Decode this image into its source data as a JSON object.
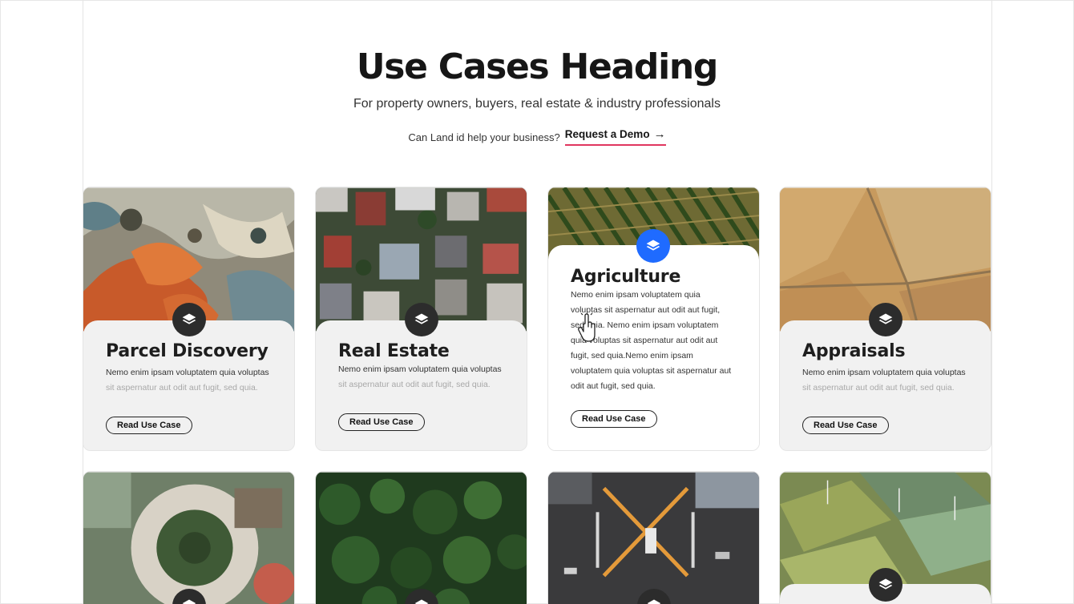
{
  "header": {
    "title": "Use Cases Heading",
    "subtitle": "For property owners, buyers, real estate & industry professionals",
    "cta_prompt": "Can Land id  help your business?",
    "cta_link": "Request a Demo",
    "accent_color": "#e0365f"
  },
  "cards": [
    {
      "title": "Parcel Discovery",
      "desc_main": "Nemo enim ipsam voluptatem quia voluptas",
      "desc_fade": "sit aspernatur aut odit aut fugit, sed quia.",
      "button": "Read Use Case",
      "icon": "layers-icon"
    },
    {
      "title": "Real Estate",
      "desc_main": "Nemo enim ipsam voluptatem quia voluptas",
      "desc_fade": "sit aspernatur aut odit aut fugit, sed quia.",
      "button": "Read Use Case",
      "icon": "layers-icon"
    },
    {
      "title": "Agriculture",
      "desc_main": "Nemo enim ipsam voluptatem quia voluptas sit aspernatur aut odit aut fugit, sed quia. Nemo enim ipsam voluptatem quia voluptas sit aspernatur aut odit aut fugit, sed quia.Nemo enim ipsam voluptatem quia voluptas sit aspernatur aut odit aut fugit, sed quia.",
      "desc_fade": "",
      "button": "Read Use Case",
      "icon": "layers-icon",
      "active_color": "#1f6bff"
    },
    {
      "title": "Appraisals",
      "desc_main": "Nemo enim ipsam voluptatem quia voluptas",
      "desc_fade": "sit aspernatur aut odit aut fugit, sed quia.",
      "button": "Read Use Case",
      "icon": "layers-icon"
    }
  ],
  "second_row_images": [
    "urban-courtyard-photo",
    "forest-canopy-photo",
    "city-intersection-photo",
    "wind-farm-fields-photo"
  ]
}
